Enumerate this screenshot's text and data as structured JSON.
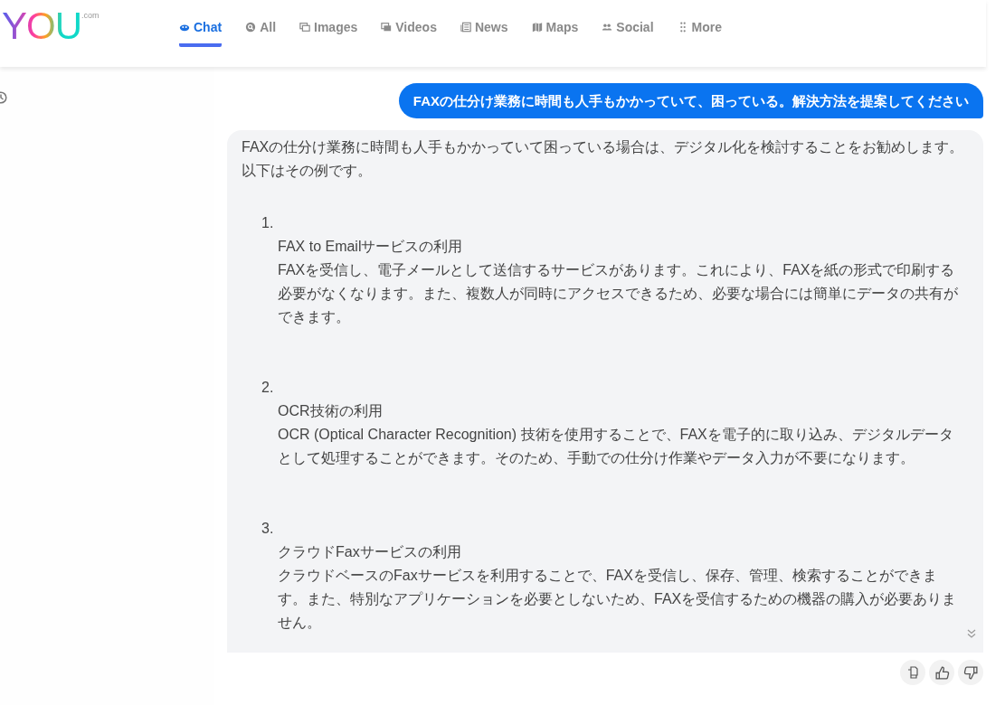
{
  "logo": {
    "text": "YOU",
    "suffix": ".com"
  },
  "tabs": [
    {
      "label": "Chat",
      "kind": "chat",
      "selected": true
    },
    {
      "label": "All",
      "kind": "search",
      "selected": false
    },
    {
      "label": "Images",
      "kind": "images",
      "selected": false
    },
    {
      "label": "Videos",
      "kind": "videos",
      "selected": false
    },
    {
      "label": "News",
      "kind": "news",
      "selected": false
    },
    {
      "label": "Maps",
      "kind": "maps",
      "selected": false
    },
    {
      "label": "Social",
      "kind": "social",
      "selected": false
    },
    {
      "label": "More",
      "kind": "more",
      "selected": false
    }
  ],
  "user_message": "FAXの仕分け業務に時間も人手もかかっていて、困っている。解決方法を提案してください",
  "answer": {
    "intro": "FAXの仕分け業務に時間も人手もかかっていて困っている場合は、デジタル化を検討することをお勧めします。以下はその例です。",
    "items": [
      {
        "number": "1.",
        "title": "FAX to Emailサービスの利用",
        "body": "FAXを受信し、電子メールとして送信するサービスがあります。これにより、FAXを紙の形式で印刷する必要がなくなります。また、複数人が同時にアクセスできるため、必要な場合には簡単にデータの共有ができます。"
      },
      {
        "number": "2.",
        "title": "OCR技術の利用",
        "body": "OCR (Optical Character Recognition) 技術を使用することで、FAXを電子的に取り込み、デジタルデータとして処理することができます。そのため、手動での仕分け作業やデータ入力が不要になります。"
      },
      {
        "number": "3.",
        "title": "クラウドFaxサービスの利用",
        "body": "クラウドベースのFaxサービスを利用することで、FAXを受信し、保存、管理、検索することができます。また、特別なアプリケーションを必要としないため、FAXを受信するための機器の購入が必要ありません。"
      }
    ]
  }
}
